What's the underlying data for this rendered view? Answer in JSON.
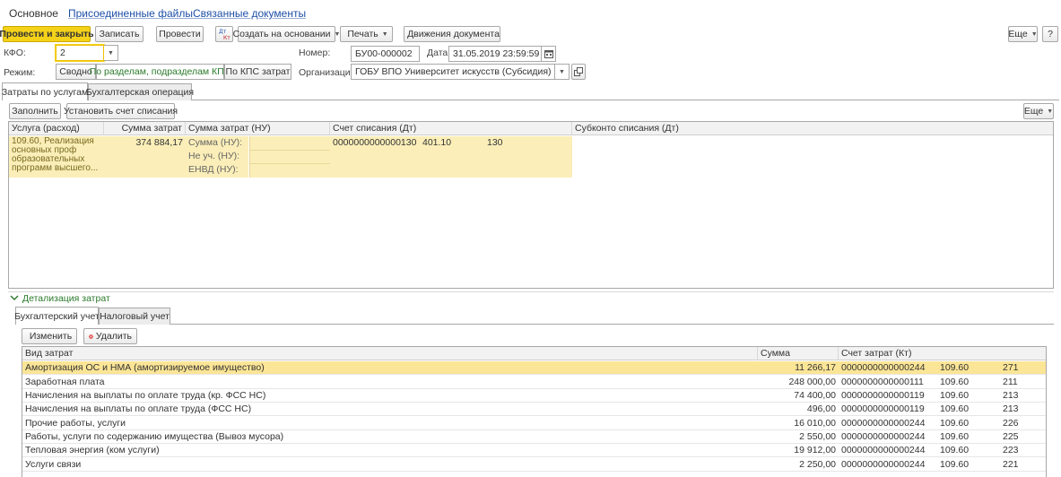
{
  "nav": {
    "main": "Основное",
    "attached": "Присоединенные файлы",
    "related": "Связанные документы"
  },
  "toolbar": {
    "post_close": "Провести и закрыть",
    "save": "Записать",
    "post": "Провести",
    "create_based": "Создать на основании",
    "print": "Печать",
    "movements": "Движения документа",
    "more": "Еще",
    "help": "?"
  },
  "form": {
    "kfo_label": "КФО:",
    "kfo_value": "2",
    "number_label": "Номер:",
    "number_value": "БУ00-000002",
    "date_label": "Дата:",
    "date_value": "31.05.2019 23:59:59",
    "mode_label": "Режим:",
    "mode_options": [
      "Сводно",
      "По разделам, подразделам КПС",
      "По КПС затрат"
    ],
    "org_label": "Организация:",
    "org_value": "ГОБУ ВПО Университет искусств (Субсидия)"
  },
  "tabs": {
    "costs": "Затраты по услугам",
    "accounting_op": "Бухгалтерская операция"
  },
  "costs_toolbar": {
    "fill": "Заполнить",
    "set_account": "Установить счет списания",
    "more": "Еще"
  },
  "costs_table": {
    "headers": {
      "service": "Услуга (расход)",
      "sum": "Сумма затрат",
      "sum_nu": "Сумма затрат (НУ)",
      "account": "Счет списания (Дт)",
      "subconto": "Субконто списания (Дт)"
    },
    "row": {
      "service": "109.60, Реализация основных проф образовательных программ высшего...",
      "sum": "374 884,17",
      "sum_nu_label": "Сумма (НУ):",
      "not_counted_label": "Не уч. (НУ):",
      "envd_label": "ЕНВД (НУ):",
      "account_code": "0000000000000130",
      "account": "401.10",
      "kosgu": "130"
    }
  },
  "detail": {
    "title": "Детализация затрат",
    "tab_accounting": "Бухгалтерский учет",
    "tab_tax": "Налоговый учет",
    "edit": "Изменить",
    "delete": "Удалить",
    "headers": {
      "type": "Вид затрат",
      "sum": "Сумма",
      "account": "Счет затрат (Кт)"
    },
    "rows": [
      {
        "type": "Амортизация ОС и НМА (амортизируемое имущество)",
        "sum": "11 266,17",
        "code": "0000000000000244",
        "acc": "109.60",
        "kosgu": "271"
      },
      {
        "type": "Заработная плата",
        "sum": "248 000,00",
        "code": "0000000000000111",
        "acc": "109.60",
        "kosgu": "211"
      },
      {
        "type": "Начисления на выплаты по оплате труда (кр. ФСС НС)",
        "sum": "74 400,00",
        "code": "0000000000000119",
        "acc": "109.60",
        "kosgu": "213"
      },
      {
        "type": "Начисления на выплаты по оплате труда (ФСС НС)",
        "sum": "496,00",
        "code": "0000000000000119",
        "acc": "109.60",
        "kosgu": "213"
      },
      {
        "type": "Прочие работы, услуги",
        "sum": "16 010,00",
        "code": "0000000000000244",
        "acc": "109.60",
        "kosgu": "226"
      },
      {
        "type": "Работы, услуги по содержанию имущества (Вывоз мусора)",
        "sum": "2 550,00",
        "code": "0000000000000244",
        "acc": "109.60",
        "kosgu": "225"
      },
      {
        "type": "Тепловая энергия (ком услуги)",
        "sum": "19 912,00",
        "code": "0000000000000244",
        "acc": "109.60",
        "kosgu": "223"
      },
      {
        "type": "Услуги связи",
        "sum": "2 250,00",
        "code": "0000000000000244",
        "acc": "109.60",
        "kosgu": "221"
      }
    ]
  },
  "colors": {
    "primary_button": "#f5d21a",
    "selected_row": "#fbe596",
    "link": "#1f4fa8",
    "section_title": "#2a7a2a"
  }
}
